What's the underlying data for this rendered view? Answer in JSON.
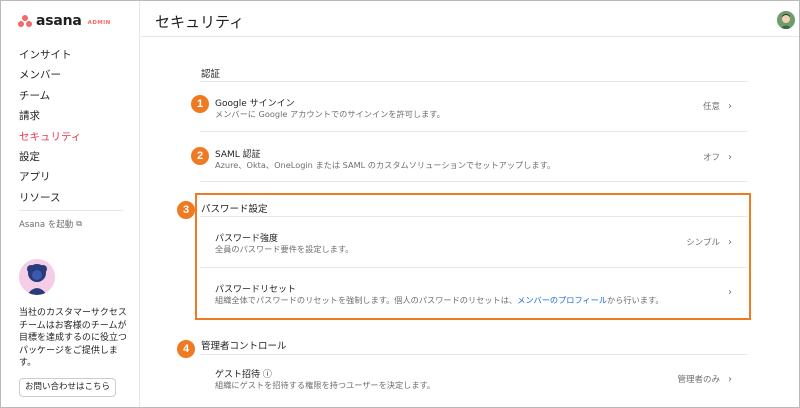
{
  "app": {
    "logo_text": "asana",
    "logo_badge": "ADMIN",
    "page_title": "セキュリティ"
  },
  "sidebar": {
    "items": [
      {
        "label": "インサイト"
      },
      {
        "label": "メンバー"
      },
      {
        "label": "チーム"
      },
      {
        "label": "請求"
      },
      {
        "label": "セキュリティ",
        "active": true
      },
      {
        "label": "設定"
      },
      {
        "label": "アプリ"
      },
      {
        "label": "リソース"
      }
    ],
    "launch_label": "Asana を起動",
    "cs_text": "当社のカスタマーサクセスチームはお客様のチームが目標を達成するのに役立つパッケージをご提供します。",
    "contact_button": "お問い合わせはこちら"
  },
  "sections": {
    "auth": {
      "title": "認証",
      "google": {
        "title": "Google サインイン",
        "desc": "メンバーに Google アカウントでのサインインを許可します。",
        "value": "任意"
      },
      "saml": {
        "title": "SAML 認証",
        "desc": "Azure、Okta、OneLogin または SAML のカスタムソリューションでセットアップします。",
        "value": "オフ"
      }
    },
    "password": {
      "title": "パスワード設定",
      "strength": {
        "title": "パスワード強度",
        "desc": "全員のパスワード要件を設定します。",
        "value": "シンプル"
      },
      "reset": {
        "title": "パスワードリセット",
        "desc_before": "組織全体でパスワードのリセットを強制します。個人のパスワードのリセットは、",
        "desc_link": "メンバーのプロフィール",
        "desc_after": "から行います。"
      }
    },
    "admin": {
      "title": "管理者コントロール",
      "guest": {
        "title": "ゲスト招待 ⓘ",
        "desc": "組織にゲストを招待する権限を持つユーザーを決定します。",
        "value": "管理者のみ"
      }
    }
  },
  "badges": [
    "1",
    "2",
    "3",
    "4"
  ],
  "colors": {
    "accent_badge": "#ee7a23",
    "active_nav": "#e8384f",
    "link": "#1e6cd6",
    "brand": "#f06a6a"
  }
}
